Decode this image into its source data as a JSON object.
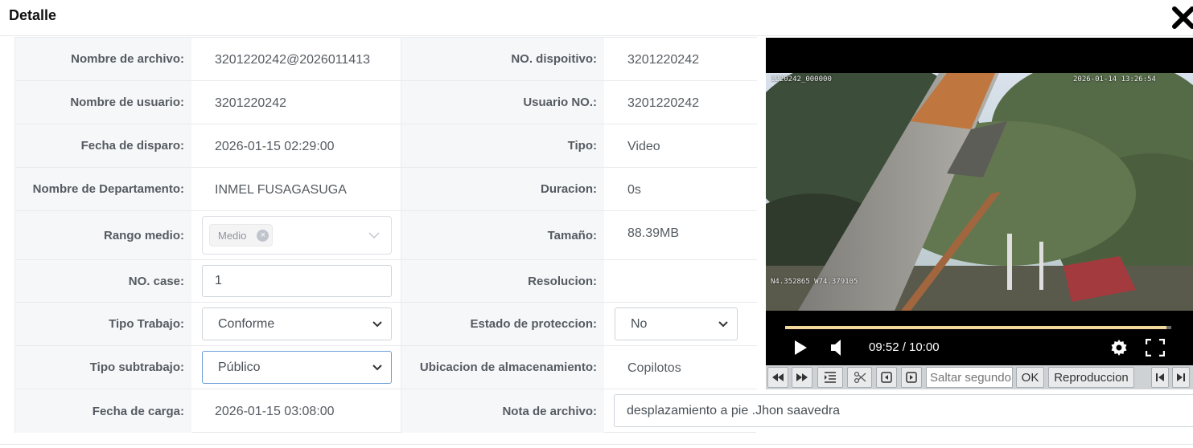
{
  "dialog": {
    "title": "Detalle",
    "close_icon": "close-icon"
  },
  "rows": [
    {
      "label1": "Nombre de archivo:",
      "value1": "3201220242@2026011413",
      "label2": "NO. dispoitivo:",
      "value2": "3201220242"
    },
    {
      "label1": "Nombre de usuario:",
      "value1": "3201220242",
      "label2": "Usuario NO.:",
      "value2": "3201220242"
    },
    {
      "label1": "Fecha de disparo:",
      "value1": "2026-01-15 02:29:00",
      "label2": "Tipo:",
      "value2": "Video"
    },
    {
      "label1": "Nombre de Departamento:",
      "value1": "INMEL FUSAGASUGA",
      "label2": "Duracion:",
      "value2": "0s"
    },
    {
      "label1": "Rango medio:",
      "tag": "Medio",
      "label2": "Tamaño:",
      "value2": "88.39MB"
    },
    {
      "label1": "NO. case:",
      "input_value": "1",
      "label2": "Resolucion:",
      "value2": ""
    },
    {
      "label1": "Tipo Trabajo:",
      "select1": "Conforme",
      "label2": "Estado de proteccion:",
      "select2": "No"
    },
    {
      "label1": "Tipo subtrabajo:",
      "select1": "Público",
      "label2": "Ubicacion de almacenamiento:",
      "value2": "Copilotos"
    },
    {
      "label1": "Fecha de carga:",
      "value1": "2026-01-15 03:08:00",
      "label2": "Nota de archivo:",
      "nota": "desplazamiento a pie .Jhon saavedra"
    }
  ],
  "player": {
    "osd_top_left": "1220242_000000",
    "osd_top_right": "2026-01-14 13:26:54",
    "osd_bottom_left": "N4.352865 W74.379105",
    "time": "09:52 / 10:00",
    "progress": 0.987
  },
  "toolbar": {
    "seek_placeholder": "Saltar segundo",
    "ok_label": "OK",
    "playback_label": "Reproduccion"
  }
}
